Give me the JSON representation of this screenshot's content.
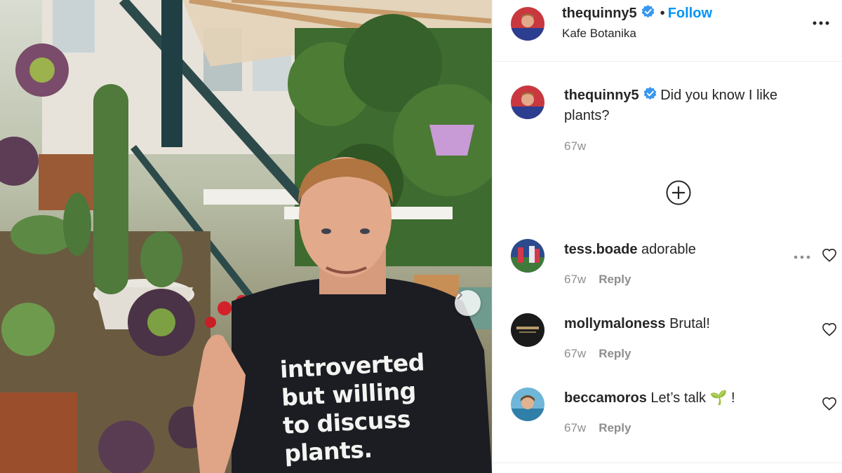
{
  "post": {
    "shirt_lines": [
      "introverted",
      "but willing",
      "to discuss",
      "plants."
    ]
  },
  "header": {
    "username": "thequinny5",
    "separator": "•",
    "follow_label": "Follow",
    "location": "Kafe Botanika"
  },
  "caption": {
    "username": "thequinny5",
    "text": "Did you know I like plants?",
    "time": "67w"
  },
  "comments": [
    {
      "username": "tess.boade",
      "text": "adorable",
      "time": "67w",
      "reply_label": "Reply"
    },
    {
      "username": "mollymaloness",
      "text": "Brutal!",
      "time": "67w",
      "reply_label": "Reply"
    },
    {
      "username": "beccamoros",
      "text": "Let’s talk",
      "emoji": "🌱",
      "suffix": "!",
      "time": "67w",
      "reply_label": "Reply"
    }
  ],
  "colors": {
    "accent": "#0095f6",
    "verified": "#3897f0",
    "muted": "#8e8e8e"
  },
  "icons": [
    "verified-badge-icon",
    "more-options-icon",
    "load-more-plus-icon",
    "heart-icon",
    "next-arrow-icon"
  ]
}
